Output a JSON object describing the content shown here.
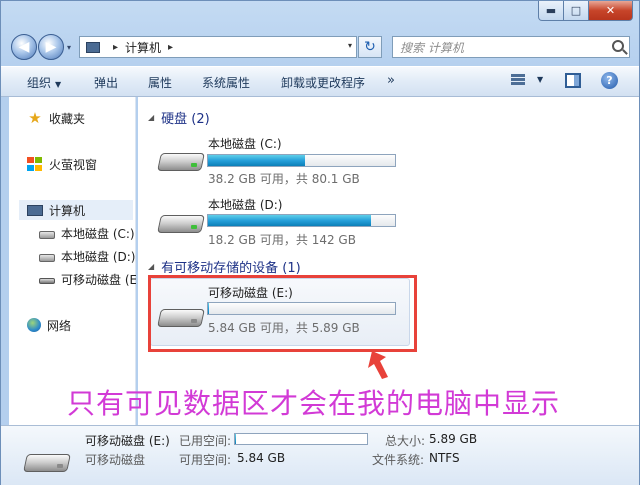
{
  "window": {
    "caption_buttons": {
      "minimize": "▬",
      "maximize": "□",
      "close": "✕"
    }
  },
  "address": {
    "back_icon": "◀",
    "forward_icon": "▶",
    "path_root_sep": "▸",
    "path_item": "计算机",
    "path_trailing_sep": "▸",
    "dropdown": "▾",
    "refresh_icon": "↻"
  },
  "search": {
    "placeholder": "搜索 计算机"
  },
  "toolbar": {
    "organize": "组织",
    "eject": "弹出",
    "properties": "属性",
    "system_properties": "系统属性",
    "uninstall": "卸载或更改程序",
    "more": "»",
    "help": "?"
  },
  "navpane": {
    "favorites": "收藏夹",
    "huorong": "火萤视窗",
    "computer": "计算机",
    "drive_c": "本地磁盘 (C:)",
    "drive_d": "本地磁盘 (D:)",
    "drive_e": "可移动磁盘 (E",
    "network": "网络"
  },
  "content": {
    "hdd_group": "硬盘 (2)",
    "removable_group": "有可移动存储的设备 (1)",
    "drives": [
      {
        "name": "本地磁盘 (C:)",
        "info": "38.2 GB 可用，共 80.1 GB",
        "used_fraction": 0.52
      },
      {
        "name": "本地磁盘 (D:)",
        "info": "18.2 GB 可用，共 142 GB",
        "used_fraction": 0.87
      },
      {
        "name": "可移动磁盘 (E:)",
        "info": "5.84 GB 可用，共 5.89 GB",
        "used_fraction": 0.008
      }
    ]
  },
  "annotation": {
    "text": "只有可见数据区才会在我的电脑中显示",
    "color": "#d23ad6",
    "box_color": "#e8423a"
  },
  "details": {
    "name": "可移动磁盘 (E:)",
    "type": "可移动磁盘",
    "used_label": "已用空间:",
    "used_fraction": 0.008,
    "free_label": "可用空间:",
    "free_value": "5.84 GB",
    "total_label": "总大小:",
    "total_value": "5.89 GB",
    "fs_label": "文件系统:",
    "fs_value": "NTFS"
  }
}
